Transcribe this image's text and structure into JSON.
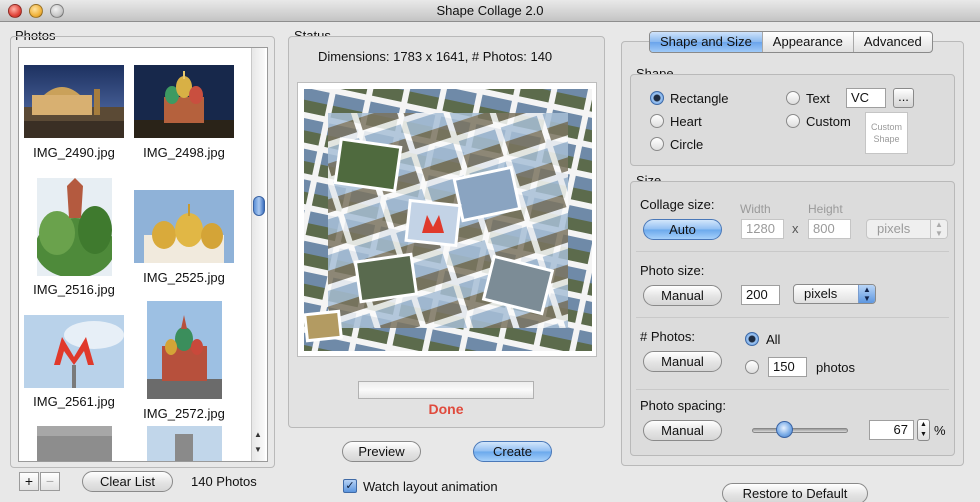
{
  "window": {
    "title": "Shape Collage 2.0"
  },
  "photos": {
    "title": "Photos",
    "items": [
      {
        "name": "IMG_2490.jpg"
      },
      {
        "name": "IMG_2498.jpg"
      },
      {
        "name": "IMG_2516.jpg"
      },
      {
        "name": "IMG_2525.jpg"
      },
      {
        "name": "IMG_2561.jpg"
      },
      {
        "name": "IMG_2572.jpg"
      }
    ],
    "add_label": "+",
    "remove_label": "−",
    "clear_label": "Clear List",
    "count_label": "140 Photos"
  },
  "status": {
    "title": "Status",
    "dimensions": "Dimensions: 1783 x 1641, # Photos: 140",
    "done_label": "Done",
    "preview_label": "Preview",
    "create_label": "Create",
    "watch_label": "Watch layout animation",
    "watch_checked": true,
    "check_mark": "✓"
  },
  "tabs": [
    {
      "label": "Shape and Size",
      "active": true
    },
    {
      "label": "Appearance",
      "active": false
    },
    {
      "label": "Advanced",
      "active": false
    }
  ],
  "shape": {
    "title": "Shape",
    "options": {
      "rectangle": "Rectangle",
      "heart": "Heart",
      "circle": "Circle",
      "text": "Text",
      "custom": "Custom"
    },
    "selected": "Rectangle",
    "text_value": "VC",
    "browse_label": "...",
    "custom_shape_label": "Custom Shape"
  },
  "size": {
    "title": "Size",
    "collage_size_label": "Collage size:",
    "auto_label": "Auto",
    "width_label": "Width",
    "height_label": "Height",
    "width_value": "1280",
    "times": "x",
    "height_value": "800",
    "units_disabled": "pixels",
    "photo_size_label": "Photo size:",
    "photo_size_manual": "Manual",
    "photo_size_value": "200",
    "photo_size_units": "pixels",
    "photos_label": "# Photos:",
    "photos_manual": "Manual",
    "photos_all": "All",
    "photos_value": "150",
    "photos_unit": "photos",
    "photos_selected": "All",
    "spacing_label": "Photo spacing:",
    "spacing_manual": "Manual",
    "spacing_value": "67",
    "spacing_percent": "%",
    "spacing_fraction": 0.33
  },
  "restore_label": "Restore to Default",
  "colors": {
    "accent_blue": "#6aa8ec",
    "done_red": "#e04a3c"
  }
}
